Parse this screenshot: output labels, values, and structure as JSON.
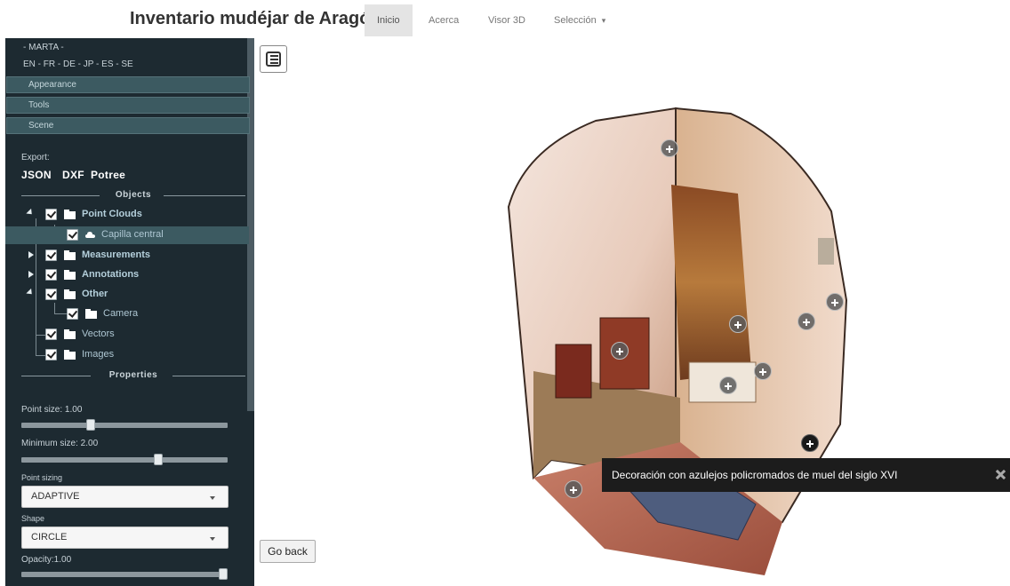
{
  "header": {
    "brand": "Inventario mudéjar de Aragón",
    "nav": [
      {
        "label": "Inicio",
        "active": true
      },
      {
        "label": "Acerca",
        "active": false
      },
      {
        "label": "Visor 3D",
        "active": false
      },
      {
        "label": "Selección",
        "active": false,
        "dropdown": true
      }
    ],
    "dropdown_caret": "▾"
  },
  "sidebar": {
    "user": "- MARTA -",
    "languages": "EN - FR - DE - JP - ES - SE",
    "panels": [
      "Appearance",
      "Tools",
      "Scene"
    ],
    "export": {
      "label": "Export:",
      "formats": [
        "JSON",
        "DXF",
        "Potree"
      ]
    },
    "objects": {
      "title": "Objects",
      "items": [
        {
          "label": "Point Clouds",
          "checked": true,
          "bold": true,
          "expanded": true,
          "icon": "folder-icon"
        },
        {
          "label": "Capilla central",
          "checked": true,
          "bold": false,
          "selected": true,
          "icon": "cloud-icon"
        },
        {
          "label": "Measurements",
          "checked": true,
          "bold": true,
          "expanded": false,
          "icon": "folder-icon"
        },
        {
          "label": "Annotations",
          "checked": true,
          "bold": true,
          "expanded": false,
          "icon": "folder-icon"
        },
        {
          "label": "Other",
          "checked": true,
          "bold": true,
          "expanded": true,
          "icon": "folder-icon"
        },
        {
          "label": "Camera",
          "checked": true,
          "bold": false,
          "icon": "folder-icon"
        },
        {
          "label": "Vectors",
          "checked": true,
          "bold": false,
          "icon": "folder-icon"
        },
        {
          "label": "Images",
          "checked": true,
          "bold": false,
          "icon": "folder-icon"
        }
      ]
    },
    "properties": {
      "title": "Properties",
      "point_size": {
        "label": "Point size: 1.00",
        "value_fraction": 0.33
      },
      "min_size": {
        "label": "Minimum size: 2.00",
        "value_fraction": 0.67
      },
      "point_sizing": {
        "label": "Point sizing",
        "value": "ADAPTIVE"
      },
      "shape": {
        "label": "Shape",
        "value": "CIRCLE"
      },
      "opacity": {
        "label": "Opacity:1.00",
        "value_fraction": 1.0
      }
    }
  },
  "viewer": {
    "menu_icon": "hamburger-menu-icon",
    "go_back": "Go back",
    "annotation_count": 11,
    "tooltip": "Decoración con azulejos policromados de muel del siglo XVI",
    "close_icon": "close-icon"
  },
  "colors": {
    "sidebar_bg": "#1d2a31",
    "panel_bg": "#3c5a61",
    "tree_label": "#aec7d3",
    "tooltip_bg": "#1c1c1c",
    "nav_active_bg": "#e4e4e4"
  }
}
